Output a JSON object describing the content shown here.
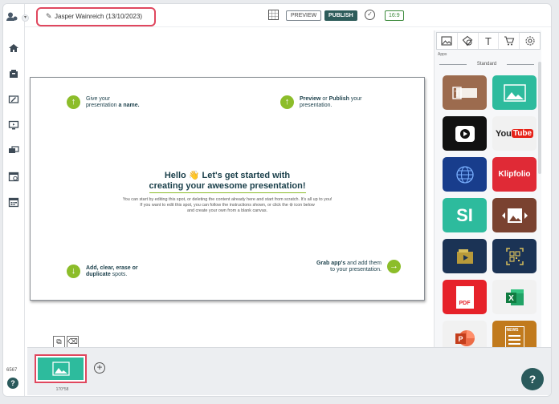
{
  "header": {
    "presentation_title": "Jasper Wainreich (13/10/2023)",
    "preview_label": "PREVIEW",
    "publish_label": "PUBLISH",
    "ratio_label": "16:9"
  },
  "rail": {
    "version": "6567",
    "help": "?"
  },
  "slide": {
    "top_left": {
      "arrow": "↑",
      "pre": "Give your presentation ",
      "bold": "a name."
    },
    "top_right": {
      "arrow": "↑",
      "b1": "Preview",
      "mid": " or ",
      "b2": "Publish",
      "post": " your presentation."
    },
    "bottom_left": {
      "arrow": "↓",
      "b1": "Add, clear, erase or",
      "b2": "duplicate",
      "post": " spots."
    },
    "bottom_right": {
      "arrow": "→",
      "b1": "Grab app's",
      "post": " and add them to your presentation."
    },
    "hello_line1": "Hello 👋 Let's get started with",
    "hello_line2": "creating your awesome presentation!",
    "body_line1": "You can start by editing this spot, or deleting the content already here and start from scratch. It's all up to you!",
    "body_line2": "If you want to edit this spot, you can follow the instructions shown, or click the ⊛ icon below",
    "body_line3": "and create your own from a blank canvas."
  },
  "panel": {
    "apps_label": "Apps",
    "section_label": "Standard",
    "tiles": [
      {
        "name": "text",
        "color": "#9c6b4e"
      },
      {
        "name": "image",
        "color": "#2dbb9d"
      },
      {
        "name": "video",
        "color": "#111111"
      },
      {
        "name": "youtube",
        "label": "YouTube",
        "color": "#f1f1f1"
      },
      {
        "name": "web",
        "color": "#183d8c"
      },
      {
        "name": "klipfolio",
        "label": "Klipfolio",
        "color": "#e02a36"
      },
      {
        "name": "si",
        "label": "SI",
        "color": "#2dbb9d"
      },
      {
        "name": "slideshow",
        "color": "#7a4230"
      },
      {
        "name": "folder",
        "color": "#1b3355"
      },
      {
        "name": "qr",
        "color": "#1b3355"
      },
      {
        "name": "pdf",
        "label": "PDF",
        "color": "#e6222a"
      },
      {
        "name": "excel",
        "color": "#f1f1f1"
      },
      {
        "name": "powerpoint",
        "color": "#f1f1f1"
      },
      {
        "name": "news",
        "label": "NEWS",
        "color": "#c17a1d"
      }
    ]
  },
  "strip": {
    "thumb_size": "170*58",
    "add": "+"
  },
  "help_button": "?"
}
